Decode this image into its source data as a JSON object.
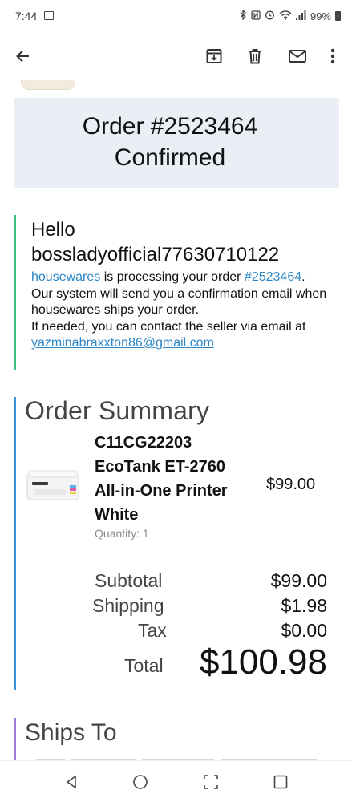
{
  "status_bar": {
    "time": "7:44",
    "battery": "99%"
  },
  "email": {
    "banner": {
      "title_line1": "Order #2523464",
      "title_line2": "Confirmed"
    },
    "hello": {
      "greeting_line1": "Hello",
      "greeting_line2": "bossladyofficial77630710122",
      "seller_link": "housewares",
      "processing_text": " is processing your order ",
      "order_link": "#2523464",
      "period": ".",
      "system_text": "Our system will send you a confirmation email when housewares ships your order.",
      "contact_text": "If needed, you can contact the seller via email at ",
      "seller_email": "yazminabraxxton86@gmail.com"
    },
    "summary": {
      "title": "Order Summary",
      "product": {
        "name": "C11CG22203 EcoTank ET-2760 All-in-One Printer White",
        "price": "$99.00",
        "quantity": "Quantity: 1"
      },
      "subtotal_label": "Subtotal",
      "subtotal_value": "$99.00",
      "shipping_label": "Shipping",
      "shipping_value": "$1.98",
      "tax_label": "Tax",
      "tax_value": "$0.00",
      "total_label": "Total",
      "total_value": "$100.98"
    },
    "ships_to": {
      "title": "Ships To"
    }
  },
  "colors": {
    "hello_accent": "#3fbf7d",
    "summary_accent": "#3d92d6",
    "ships_accent": "#9a7ad2",
    "banner_bg": "#e9eff4",
    "link": "#2a86c7"
  },
  "icons": {
    "back": "arrow-left-icon",
    "archive": "archive-icon",
    "delete": "trash-icon",
    "mail": "envelope-icon",
    "more": "more-vert-icon"
  }
}
